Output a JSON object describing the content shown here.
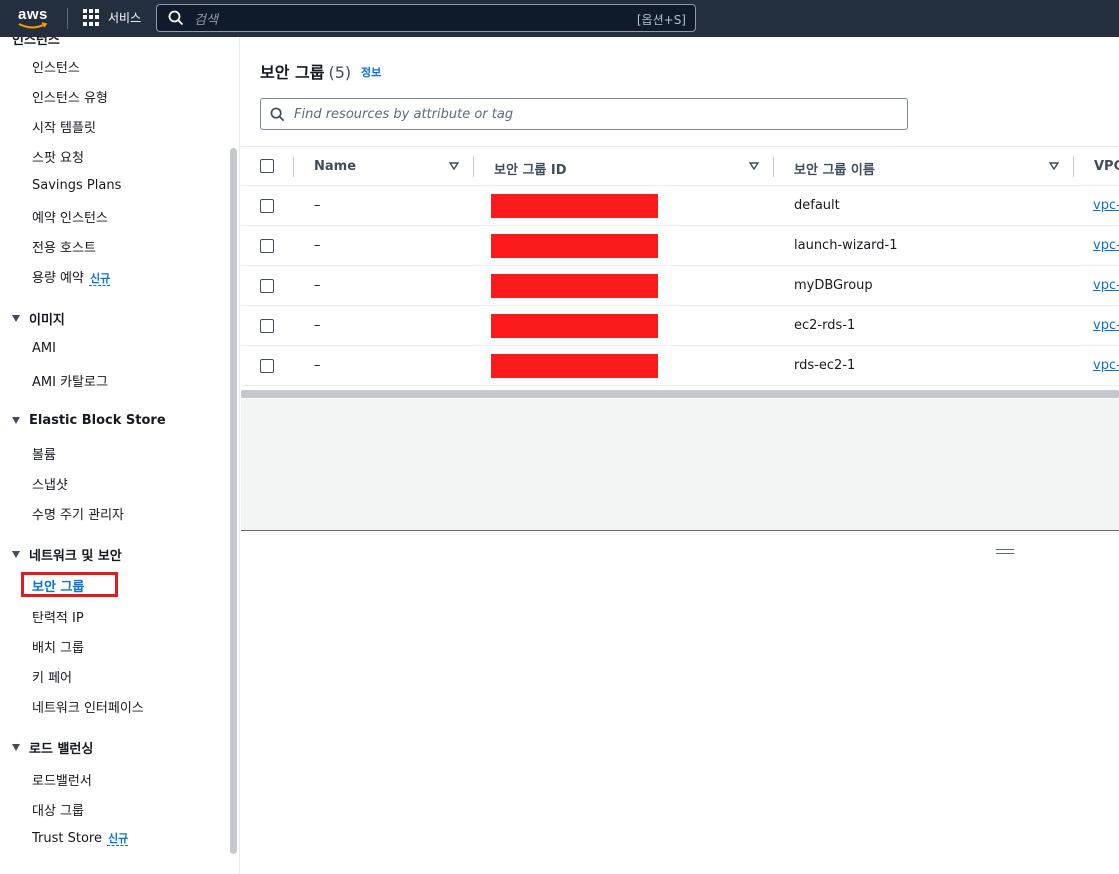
{
  "topnav": {
    "logo": "aws",
    "services_label": "서비스",
    "search_placeholder": "검색",
    "search_shortcut": "[옵션+S]"
  },
  "sidebar": {
    "cut_section": "인스턴스",
    "groups": [
      {
        "items": [
          "인스턴스",
          "인스턴스 유형",
          "시작 템플릿",
          "스팟 요청",
          "Savings Plans",
          "예약 인스턴스",
          "전용 호스트",
          "용량 예약"
        ]
      },
      {
        "title": "이미지",
        "items": [
          "AMI",
          "AMI 카탈로그"
        ]
      },
      {
        "title": "Elastic Block Store",
        "items": [
          "볼륨",
          "스냅샷",
          "수명 주기 관리자"
        ]
      },
      {
        "title": "네트워크 및 보안",
        "items": [
          "보안 그룹",
          "탄력적 IP",
          "배치 그룹",
          "키 페어",
          "네트워크 인터페이스"
        ]
      },
      {
        "title": "로드 밸런싱",
        "items": [
          "로드밸런서",
          "대상 그룹",
          "Trust Store"
        ]
      }
    ],
    "new_badge": "신규",
    "active_item": "보안 그룹"
  },
  "panel": {
    "title": "보안 그룹",
    "count": "(5)",
    "info": "정보",
    "filter_placeholder": "Find resources by attribute or tag"
  },
  "table": {
    "columns": [
      "Name",
      "보안 그룹 ID",
      "보안 그룹 이름",
      "VPC"
    ],
    "rows": [
      {
        "name": "–",
        "group_name": "default",
        "vpc": "vpc-"
      },
      {
        "name": "–",
        "group_name": "launch-wizard-1",
        "vpc": "vpc-"
      },
      {
        "name": "–",
        "group_name": "myDBGroup",
        "vpc": "vpc-"
      },
      {
        "name": "–",
        "group_name": "ec2-rds-1",
        "vpc": "vpc-"
      },
      {
        "name": "–",
        "group_name": "rds-ec2-1",
        "vpc": "vpc-"
      }
    ]
  },
  "colors": {
    "nav_bg": "#232f3e",
    "link": "#0972d3",
    "redaction": "#fc1b1b",
    "highlight": "#e31b1b"
  }
}
